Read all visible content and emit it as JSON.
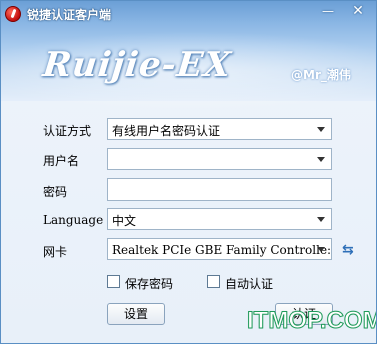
{
  "titlebar": {
    "title": "锐捷认证客户端",
    "minimize_symbol": "—",
    "close_symbol": "✕",
    "app_icon": "ruijie-app-icon"
  },
  "branding": {
    "logo_text": "Ruijie-EX",
    "signature": "@Mr_潮伟"
  },
  "form": {
    "auth_method": {
      "label": "认证方式",
      "value": "有线用户名密码认证"
    },
    "username": {
      "label": "用户名",
      "value": ""
    },
    "password": {
      "label": "密码",
      "value": ""
    },
    "language": {
      "label": "Language",
      "value": "中文"
    },
    "nic": {
      "label": "网卡",
      "value": "Realtek PCIe GBE Family Controlle:",
      "refresh_icon": "refresh-icon"
    }
  },
  "options": {
    "save_password": {
      "label": "保存密码",
      "checked": false
    },
    "auto_auth": {
      "label": "自动认证",
      "checked": false
    }
  },
  "buttons": {
    "settings": "设置",
    "authenticate": "认证"
  },
  "watermark": "ITMOP.COM",
  "colors": {
    "title_blue": "#6b9fd6",
    "window_bg": "#e8f0f9",
    "watermark_green": "#1f9a5a"
  }
}
